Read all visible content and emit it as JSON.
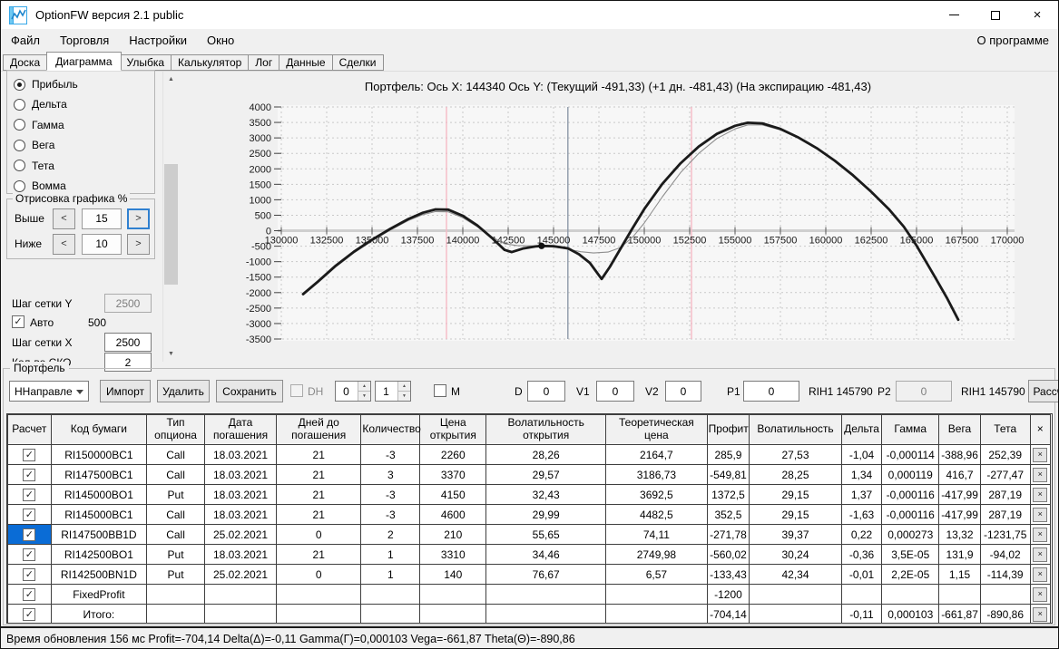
{
  "window": {
    "title": "OptionFW версия 2.1 public"
  },
  "icons": {
    "close_window": "×",
    "check": "✓",
    "close": "×",
    "arrow_up": "▲",
    "arrow_down": "▼",
    "spin_up": "▲",
    "spin_down": "▼"
  },
  "menu": {
    "items": [
      {
        "key": "file",
        "label": "Файл"
      },
      {
        "key": "trading",
        "label": "Торговля"
      },
      {
        "key": "settings",
        "label": "Настройки"
      },
      {
        "key": "window",
        "label": "Окно"
      }
    ],
    "right_item": "О программе"
  },
  "tabs": [
    {
      "key": "board",
      "label": "Доска",
      "active": false
    },
    {
      "key": "diagram",
      "label": "Диаграмма",
      "active": true
    },
    {
      "key": "smile",
      "label": "Улыбка",
      "active": false
    },
    {
      "key": "calculator",
      "label": "Калькулятор",
      "active": false
    },
    {
      "key": "log",
      "label": "Лог",
      "active": false
    },
    {
      "key": "data",
      "label": "Данные",
      "active": false
    },
    {
      "key": "trades",
      "label": "Сделки",
      "active": false
    }
  ],
  "left_panel": {
    "radios": [
      {
        "key": "profit",
        "label": "Прибыль",
        "checked": true
      },
      {
        "key": "delta",
        "label": "Дельта",
        "checked": false
      },
      {
        "key": "gamma",
        "label": "Гамма",
        "checked": false
      },
      {
        "key": "vega",
        "label": "Вега",
        "checked": false
      },
      {
        "key": "theta",
        "label": "Тета",
        "checked": false
      },
      {
        "key": "vomma",
        "label": "Вомма",
        "checked": false
      }
    ],
    "draw_group": {
      "title": "Отрисовка графика %",
      "above_label": "Выше",
      "above_value": "15",
      "below_label": "Ниже",
      "below_value": "10",
      "dec_label": "<",
      "inc_label": ">"
    },
    "grid_settings": {
      "step_y_label": "Шаг сетки Y",
      "step_y_value": "2500",
      "auto_label": "Авто",
      "auto_step_value": "500",
      "step_x_label": "Шаг сетки X",
      "step_x_value": "2500",
      "sko_label": "Кол-во СКО",
      "sko_value": "2"
    }
  },
  "chart_data": {
    "type": "line",
    "title": "Портфель: Ось X: 144340 Ось Y:  (Текущий -491,33)  (+1 дн. -481,43)  (На экспирацию -481,43)",
    "x_value": 144340,
    "y_current": "-491,33",
    "y_plus1d": "-481,43",
    "y_expiration": "-481,43",
    "xlim": [
      130000,
      170000
    ],
    "x_step": 2500,
    "ylim": [
      -3500,
      4000
    ],
    "y_step": 500,
    "grid": true,
    "vlines": [
      {
        "name": "sigma-line-left",
        "x": 139100,
        "color": "#f5b9c5"
      },
      {
        "name": "sigma-line-right",
        "x": 152600,
        "color": "#f5b9c5"
      },
      {
        "name": "current-price-line",
        "x": 145790,
        "color": "#8c99a8"
      }
    ],
    "marker": {
      "x": 144340,
      "y": -491.33,
      "color": "#111111"
    },
    "series": [
      {
        "name": "Текущий",
        "color": "#8e8e8e",
        "width": 1.1,
        "points": [
          [
            131200,
            -2080
          ],
          [
            132000,
            -1690
          ],
          [
            133000,
            -1170
          ],
          [
            134000,
            -720
          ],
          [
            135000,
            -330
          ],
          [
            136000,
            20
          ],
          [
            137000,
            330
          ],
          [
            137800,
            520
          ],
          [
            138500,
            620
          ],
          [
            139200,
            610
          ],
          [
            140000,
            420
          ],
          [
            140800,
            130
          ],
          [
            141600,
            -200
          ],
          [
            142300,
            -420
          ],
          [
            143000,
            -480
          ],
          [
            144000,
            -490
          ],
          [
            144340,
            -491
          ],
          [
            145000,
            -520
          ],
          [
            145800,
            -600
          ],
          [
            146500,
            -680
          ],
          [
            147200,
            -720
          ],
          [
            148000,
            -690
          ],
          [
            148700,
            -540
          ],
          [
            149400,
            -180
          ],
          [
            150000,
            250
          ],
          [
            151000,
            1100
          ],
          [
            152000,
            1880
          ],
          [
            153000,
            2500
          ],
          [
            154000,
            2980
          ],
          [
            155000,
            3290
          ],
          [
            155700,
            3420
          ],
          [
            156500,
            3420
          ],
          [
            157500,
            3260
          ],
          [
            158500,
            2990
          ],
          [
            159500,
            2650
          ],
          [
            160500,
            2250
          ],
          [
            161500,
            1780
          ],
          [
            162500,
            1250
          ],
          [
            163500,
            670
          ],
          [
            164300,
            120
          ],
          [
            165000,
            -490
          ],
          [
            166000,
            -1490
          ],
          [
            166700,
            -2210
          ],
          [
            167300,
            -2890
          ]
        ]
      },
      {
        "name": "На экспирацию",
        "color": "#1a1a1a",
        "width": 2.8,
        "points": [
          [
            131200,
            -2050
          ],
          [
            132000,
            -1650
          ],
          [
            133000,
            -1130
          ],
          [
            134000,
            -680
          ],
          [
            135000,
            -290
          ],
          [
            136000,
            60
          ],
          [
            137000,
            380
          ],
          [
            137800,
            580
          ],
          [
            138500,
            690
          ],
          [
            139200,
            680
          ],
          [
            140000,
            480
          ],
          [
            140800,
            170
          ],
          [
            141600,
            -230
          ],
          [
            142300,
            -620
          ],
          [
            142700,
            -690
          ],
          [
            143300,
            -580
          ],
          [
            144000,
            -510
          ],
          [
            144340,
            -491
          ],
          [
            145000,
            -500
          ],
          [
            145800,
            -570
          ],
          [
            146400,
            -760
          ],
          [
            147000,
            -1040
          ],
          [
            147650,
            -1560
          ],
          [
            148100,
            -1170
          ],
          [
            148700,
            -570
          ],
          [
            149300,
            30
          ],
          [
            150000,
            700
          ],
          [
            151000,
            1520
          ],
          [
            152000,
            2180
          ],
          [
            153000,
            2720
          ],
          [
            154000,
            3130
          ],
          [
            155000,
            3390
          ],
          [
            155700,
            3490
          ],
          [
            156500,
            3470
          ],
          [
            157500,
            3290
          ],
          [
            158500,
            3010
          ],
          [
            159500,
            2670
          ],
          [
            160500,
            2260
          ],
          [
            161500,
            1790
          ],
          [
            162500,
            1260
          ],
          [
            163500,
            680
          ],
          [
            164300,
            130
          ],
          [
            165000,
            -480
          ],
          [
            166000,
            -1480
          ],
          [
            166700,
            -2200
          ],
          [
            167300,
            -2880
          ]
        ]
      }
    ]
  },
  "portfolio": {
    "group_label": "Портфель",
    "direction_value": "ННаправле",
    "import_label": "Импорт",
    "delete_label": "Удалить",
    "save_label": "Сохранить",
    "dh_label": "DH",
    "spin1_value": "0",
    "spin2_value": "1",
    "m_label": "M",
    "d_label": "D",
    "d_value": "0",
    "v1_label": "V1",
    "v1_value": "0",
    "v2_label": "V2",
    "v2_value": "0",
    "p1_label": "P1",
    "p1_value": "0",
    "p1_ticker": "RIH1 145790",
    "p2_label": "P2",
    "p2_value": "0",
    "p2_ticker": "RIH1 145790",
    "calc_label": "Рассчи",
    "underscore_label": "_",
    "clipped_label": "П"
  },
  "table": {
    "headers": [
      "Расчет",
      "Код бумаги",
      "Тип опциона",
      "Дата погашения",
      "Дней до погашения",
      "Количество",
      "Цена открытия",
      "Волатильность открытия",
      "Теоретическая цена",
      "Профит",
      "Волатильность",
      "Дельта",
      "Гамма",
      "Вега",
      "Тета",
      "×"
    ],
    "rows": [
      {
        "checked": true,
        "selected": false,
        "profit": "green",
        "cells": [
          "RI150000BC1",
          "Call",
          "18.03.2021",
          "21",
          "-3",
          "2260",
          "28,26",
          "2164,7",
          "285,9",
          "27,53",
          "-1,04",
          "-0,000114",
          "-388,96",
          "252,39"
        ]
      },
      {
        "checked": true,
        "selected": false,
        "profit": "red",
        "cells": [
          "RI147500BC1",
          "Call",
          "18.03.2021",
          "21",
          "3",
          "3370",
          "29,57",
          "3186,73",
          "-549,81",
          "28,25",
          "1,34",
          "0,000119",
          "416,7",
          "-277,47"
        ]
      },
      {
        "checked": true,
        "selected": false,
        "profit": "green",
        "cells": [
          "RI145000BO1",
          "Put",
          "18.03.2021",
          "21",
          "-3",
          "4150",
          "32,43",
          "3692,5",
          "1372,5",
          "29,15",
          "1,37",
          "-0,000116",
          "-417,99",
          "287,19"
        ]
      },
      {
        "checked": true,
        "selected": false,
        "profit": "green",
        "cells": [
          "RI145000BC1",
          "Call",
          "18.03.2021",
          "21",
          "-3",
          "4600",
          "29,99",
          "4482,5",
          "352,5",
          "29,15",
          "-1,63",
          "-0,000116",
          "-417,99",
          "287,19"
        ]
      },
      {
        "checked": true,
        "selected": true,
        "profit": "red",
        "cells": [
          "RI147500BB1D",
          "Call",
          "25.02.2021",
          "0",
          "2",
          "210",
          "55,65",
          "74,11",
          "-271,78",
          "39,37",
          "0,22",
          "0,000273",
          "13,32",
          "-1231,75"
        ]
      },
      {
        "checked": true,
        "selected": false,
        "profit": "red",
        "cells": [
          "RI142500BO1",
          "Put",
          "18.03.2021",
          "21",
          "1",
          "3310",
          "34,46",
          "2749,98",
          "-560,02",
          "30,24",
          "-0,36",
          "3,5E-05",
          "131,9",
          "-94,02"
        ]
      },
      {
        "checked": true,
        "selected": false,
        "profit": "red",
        "cells": [
          "RI142500BN1D",
          "Put",
          "25.02.2021",
          "0",
          "1",
          "140",
          "76,67",
          "6,57",
          "-133,43",
          "42,34",
          "-0,01",
          "2,2E-05",
          "1,15",
          "-114,39"
        ]
      },
      {
        "checked": true,
        "selected": false,
        "profit": "red",
        "cells": [
          "FixedProfit",
          "",
          "",
          "",
          "",
          "",
          "",
          "",
          "-1200",
          "",
          "",
          "",
          "",
          ""
        ]
      },
      {
        "checked": true,
        "selected": false,
        "profit": "red",
        "cells": [
          "Итого:",
          "",
          "",
          "",
          "",
          "",
          "",
          "",
          "-704,14",
          "",
          "-0,11",
          "0,000103",
          "-661,87",
          "-890,86"
        ]
      }
    ]
  },
  "status": {
    "text": "Время обновления 156 мс  Profit=-704,14 Delta(Δ)=-0,11 Gamma(Γ)=0,000103 Vega=-661,87 Theta(Θ)=-890,86"
  }
}
